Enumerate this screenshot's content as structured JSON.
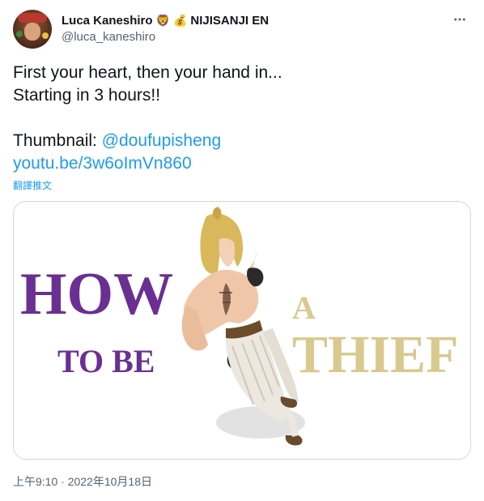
{
  "author": {
    "display_name": "Luca Kaneshiro",
    "emoji_1": "🦁",
    "emoji_2": "💰",
    "org": "NIJISANJI EN",
    "handle": "@luca_kaneshiro"
  },
  "tweet": {
    "line1": "First your heart, then your hand in...",
    "line2": "Starting in 3 hours!!",
    "thumbnail_label": "Thumbnail: ",
    "thumbnail_mention": "@doufupisheng",
    "video_link": "youtu.be/3w6oImVn860",
    "translate": "翻譯推文"
  },
  "thumbnail": {
    "word_how": "HOW",
    "word_to_be": "TO BE",
    "word_a": "A",
    "word_thief": "THIEF"
  },
  "meta": {
    "timestamp": "上午9:10 · 2022年10月18日"
  },
  "colors": {
    "purple": "#6a2f93",
    "gold": "#d9c98f",
    "link": "#1d9bf0",
    "muted": "#536471"
  },
  "icons": {
    "more": "more-horizontal-icon"
  }
}
